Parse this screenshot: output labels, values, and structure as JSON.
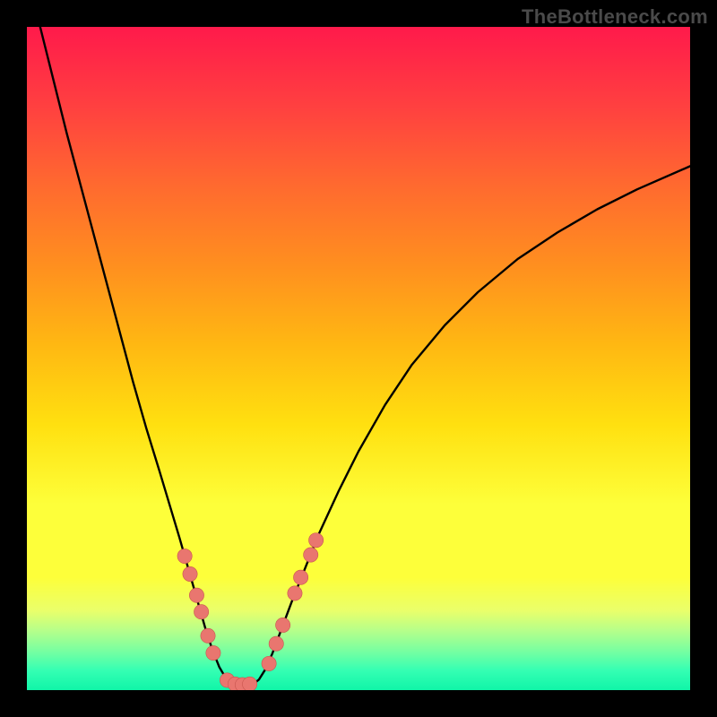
{
  "watermark": "TheBottleneck.com",
  "colors": {
    "curve": "#000000",
    "dot_fill": "#e9766f",
    "dot_stroke": "#c9564f"
  },
  "chart_data": {
    "type": "line",
    "title": "",
    "xlabel": "",
    "ylabel": "",
    "xlim": [
      0,
      100
    ],
    "ylim": [
      0,
      100
    ],
    "curve": [
      {
        "x": 2.0,
        "y": 100.0
      },
      {
        "x": 4.0,
        "y": 92.0
      },
      {
        "x": 6.0,
        "y": 84.0
      },
      {
        "x": 8.0,
        "y": 76.5
      },
      {
        "x": 10.0,
        "y": 69.0
      },
      {
        "x": 12.0,
        "y": 61.5
      },
      {
        "x": 14.0,
        "y": 54.0
      },
      {
        "x": 16.0,
        "y": 46.5
      },
      {
        "x": 18.0,
        "y": 39.5
      },
      {
        "x": 20.0,
        "y": 33.0
      },
      {
        "x": 21.5,
        "y": 28.0
      },
      {
        "x": 23.0,
        "y": 23.0
      },
      {
        "x": 24.0,
        "y": 19.5
      },
      {
        "x": 25.0,
        "y": 16.0
      },
      {
        "x": 26.0,
        "y": 12.5
      },
      {
        "x": 27.0,
        "y": 9.0
      },
      {
        "x": 28.0,
        "y": 6.0
      },
      {
        "x": 29.0,
        "y": 3.5
      },
      {
        "x": 30.0,
        "y": 1.8
      },
      {
        "x": 31.0,
        "y": 0.9
      },
      {
        "x": 32.0,
        "y": 0.5
      },
      {
        "x": 33.0,
        "y": 0.5
      },
      {
        "x": 34.0,
        "y": 0.8
      },
      {
        "x": 35.0,
        "y": 1.6
      },
      {
        "x": 36.0,
        "y": 3.2
      },
      {
        "x": 37.0,
        "y": 5.5
      },
      {
        "x": 38.5,
        "y": 9.5
      },
      {
        "x": 40.0,
        "y": 13.5
      },
      {
        "x": 42.0,
        "y": 18.5
      },
      {
        "x": 44.0,
        "y": 23.5
      },
      {
        "x": 47.0,
        "y": 30.0
      },
      {
        "x": 50.0,
        "y": 36.0
      },
      {
        "x": 54.0,
        "y": 43.0
      },
      {
        "x": 58.0,
        "y": 49.0
      },
      {
        "x": 63.0,
        "y": 55.0
      },
      {
        "x": 68.0,
        "y": 60.0
      },
      {
        "x": 74.0,
        "y": 65.0
      },
      {
        "x": 80.0,
        "y": 69.0
      },
      {
        "x": 86.0,
        "y": 72.5
      },
      {
        "x": 92.0,
        "y": 75.5
      },
      {
        "x": 100.0,
        "y": 79.0
      }
    ],
    "dots_left": [
      {
        "x": 23.8,
        "y": 20.2
      },
      {
        "x": 24.6,
        "y": 17.5
      },
      {
        "x": 25.6,
        "y": 14.3
      },
      {
        "x": 26.3,
        "y": 11.8
      },
      {
        "x": 27.3,
        "y": 8.2
      },
      {
        "x": 28.1,
        "y": 5.6
      },
      {
        "x": 30.2,
        "y": 1.5
      },
      {
        "x": 31.4,
        "y": 0.9
      },
      {
        "x": 32.5,
        "y": 0.8
      },
      {
        "x": 33.6,
        "y": 0.9
      }
    ],
    "dots_right": [
      {
        "x": 36.5,
        "y": 4.0
      },
      {
        "x": 37.6,
        "y": 7.0
      },
      {
        "x": 38.6,
        "y": 9.8
      },
      {
        "x": 40.4,
        "y": 14.6
      },
      {
        "x": 41.3,
        "y": 17.0
      },
      {
        "x": 42.8,
        "y": 20.4
      },
      {
        "x": 43.6,
        "y": 22.6
      }
    ],
    "dot_radius": 1.1
  }
}
